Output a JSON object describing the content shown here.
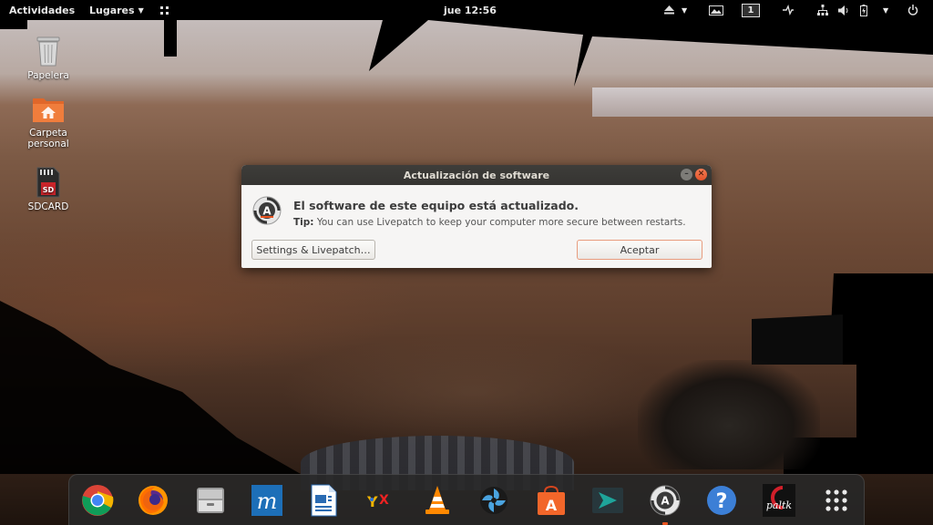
{
  "topbar": {
    "activities": "Actividades",
    "places": "Lugares",
    "clock": "jue 12:56",
    "workspace": "1"
  },
  "desktop": {
    "icons": [
      {
        "label": "Papelera",
        "icon": "trash-icon"
      },
      {
        "label": "Carpeta personal",
        "icon": "home-folder-icon"
      },
      {
        "label": "SDCARD",
        "icon": "sd-card-icon"
      }
    ]
  },
  "dialog": {
    "title": "Actualización de software",
    "heading": "El software de este equipo está actualizado.",
    "tip_label": "Tip:",
    "tip_text": " You can use Livepatch to keep your computer more secure between restarts.",
    "settings_button": "Settings & Livepatch…",
    "accept_button": "Aceptar"
  },
  "dock": {
    "apps": [
      {
        "name": "chrome-icon"
      },
      {
        "name": "firefox-icon"
      },
      {
        "name": "files-icon"
      },
      {
        "name": "m-app-icon"
      },
      {
        "name": "libreoffice-writer-icon"
      },
      {
        "name": "yx-app-icon"
      },
      {
        "name": "vlc-icon"
      },
      {
        "name": "shutter-icon"
      },
      {
        "name": "software-center-icon"
      },
      {
        "name": "terminal-arrow-icon"
      },
      {
        "name": "software-updater-icon"
      },
      {
        "name": "help-icon"
      },
      {
        "name": "paltalk-icon"
      },
      {
        "name": "show-apps-icon"
      }
    ]
  },
  "colors": {
    "accent": "#e95420",
    "titlebar": "#3e3d3a",
    "dialog_bg": "#f6f5f4"
  }
}
